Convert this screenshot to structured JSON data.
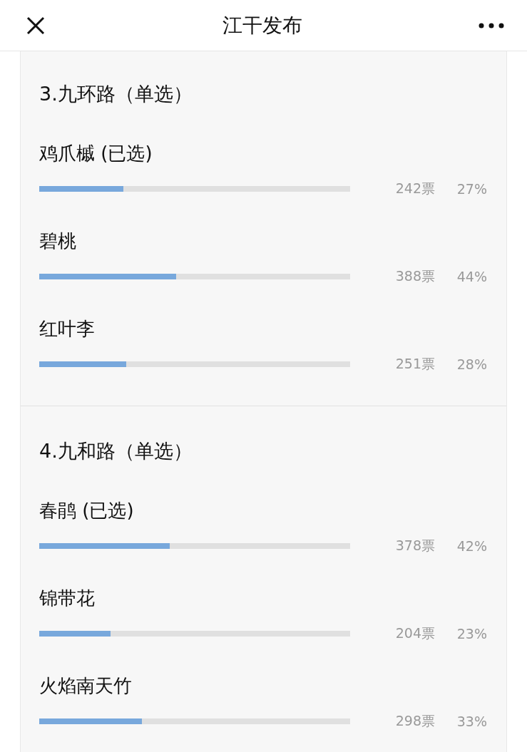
{
  "header": {
    "title": "江干发布"
  },
  "questions": [
    {
      "title": "3.九环路（单选）",
      "options": [
        {
          "label": "鸡爪槭 (已选)",
          "count": "242票",
          "percent": "27%",
          "level": 0.27
        },
        {
          "label": "碧桃",
          "count": "388票",
          "percent": "44%",
          "level": 0.44
        },
        {
          "label": "红叶李",
          "count": "251票",
          "percent": "28%",
          "level": 0.28
        }
      ]
    },
    {
      "title": "4.九和路（单选）",
      "options": [
        {
          "label": "春鹃 (已选)",
          "count": "378票",
          "percent": "42%",
          "level": 0.42
        },
        {
          "label": "锦带花",
          "count": "204票",
          "percent": "23%",
          "level": 0.23
        },
        {
          "label": "火焰南天竹",
          "count": "298票",
          "percent": "33%",
          "level": 0.33
        }
      ]
    }
  ]
}
